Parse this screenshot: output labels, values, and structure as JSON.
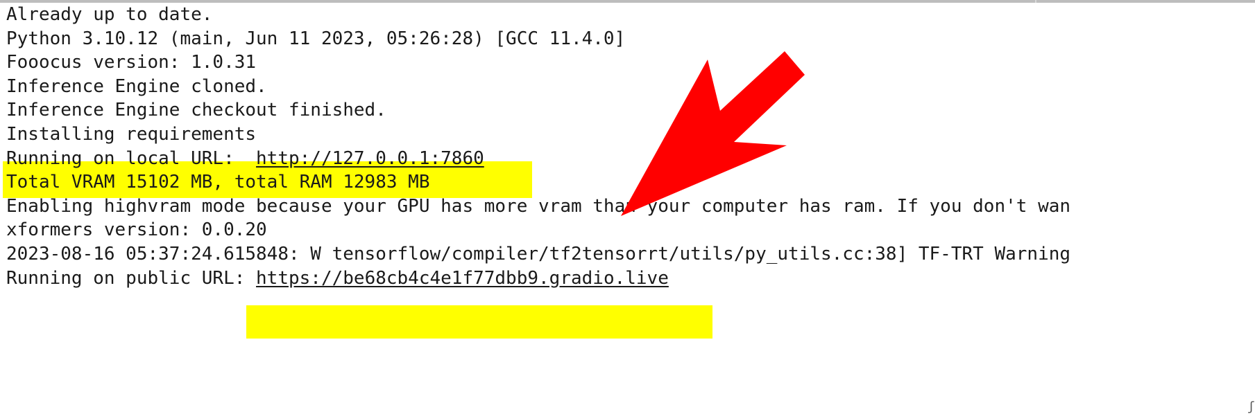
{
  "terminal": {
    "lines": [
      "Already up to date.",
      "Python 3.10.12 (main, Jun 11 2023, 05:26:28) [GCC 11.4.0]",
      "Fooocus version: 1.0.31",
      "Inference Engine cloned.",
      "Inference Engine checkout finished.",
      "Installing requirements",
      "Total VRAM 15102 MB, total RAM 12983 MB",
      "Enabling highvram mode because your GPU has more vram than your computer has ram. If you don't wan",
      "xformers version: 0.0.20",
      "2023-08-16 05:37:24.615848: W tensorflow/compiler/tf2tensorrt/utils/py_utils.cc:38] TF-TRT Warning"
    ],
    "local_url": {
      "prefix": "Running on local URL:  ",
      "url": "http://127.0.0.1:7860"
    },
    "public_url": {
      "prefix": "Running on public URL: ",
      "url": "https://be68cb4c4e1f77dbb9.gradio.live"
    }
  },
  "colors": {
    "highlight": "#ffff00",
    "arrow": "#ff0000",
    "text": "#1a1a1a"
  },
  "annotation": {
    "arrow_icon": "red-arrow-icon"
  }
}
